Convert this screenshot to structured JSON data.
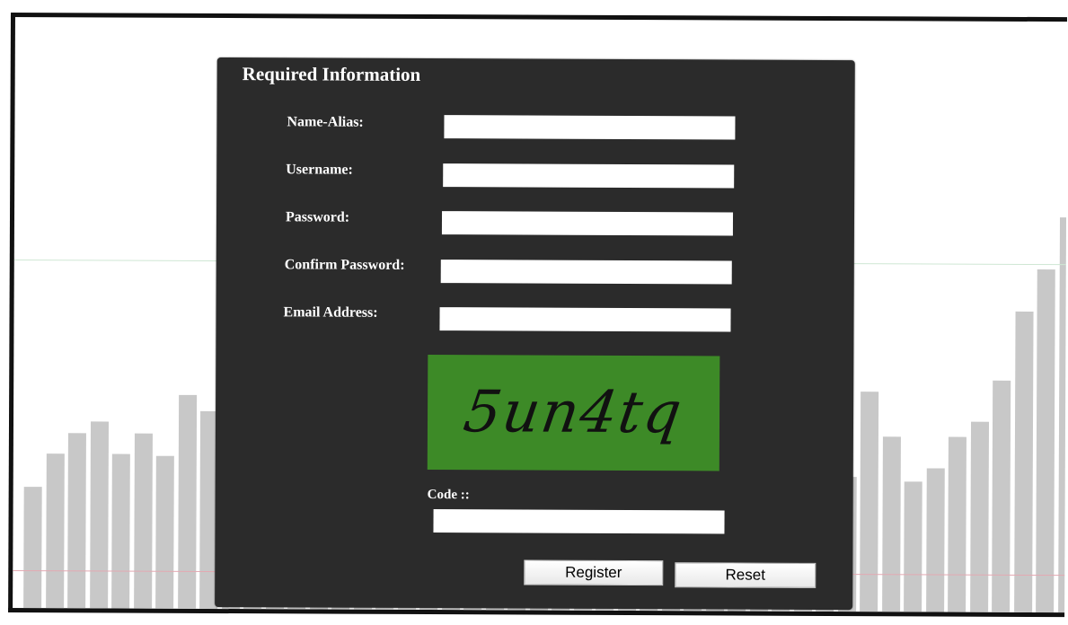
{
  "form": {
    "title": "Required Information",
    "fields": [
      {
        "label": "Name-Alias:",
        "value": ""
      },
      {
        "label": "Username:",
        "value": ""
      },
      {
        "label": "Password:",
        "value": ""
      },
      {
        "label": "Confirm Password:",
        "value": ""
      },
      {
        "label": "Email Address:",
        "value": ""
      }
    ],
    "captcha": {
      "text": "5un4tq",
      "background": "#3d8a27"
    },
    "code_label": "Code ::",
    "code_value": "",
    "register_label": "Register",
    "reset_label": "Reset"
  },
  "colors": {
    "panel": "#2b2b2b",
    "bars": "#c8c8c8"
  }
}
